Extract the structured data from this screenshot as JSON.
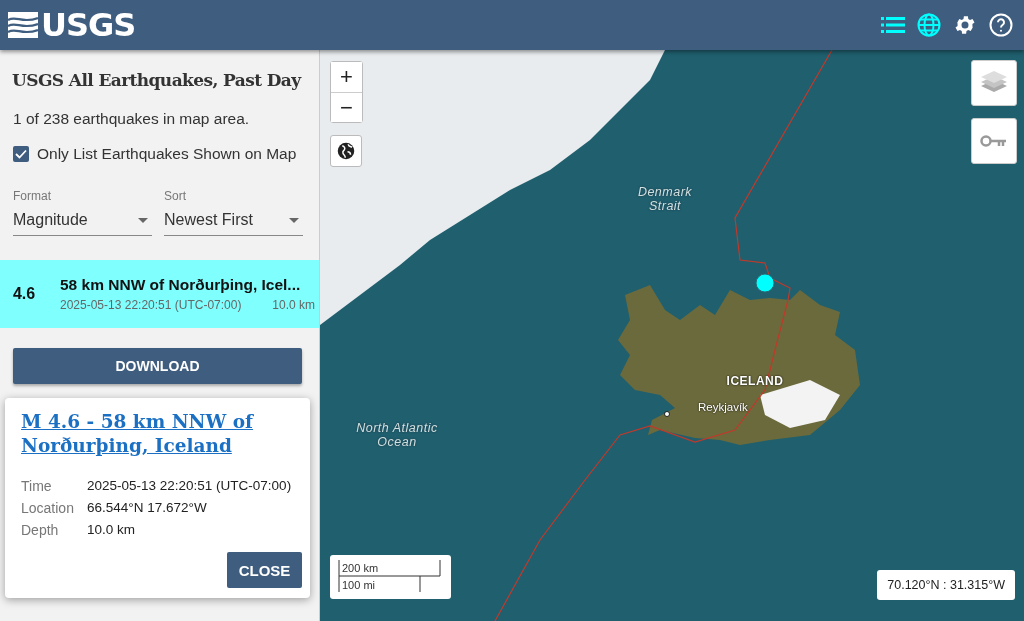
{
  "header": {
    "logo": "USGS",
    "nav": [
      {
        "kind": "list",
        "selected": true
      },
      {
        "kind": "globe",
        "selected": true
      },
      {
        "kind": "settings",
        "selected": false
      },
      {
        "kind": "help",
        "selected": false
      }
    ]
  },
  "sidebar": {
    "title": "USGS All Earthquakes, Past Day",
    "count": "1 of 238 earthquakes in map area.",
    "filter": {
      "label": "Only List Earthquakes Shown on Map",
      "checked": true
    },
    "selects": [
      {
        "label": "Format",
        "value": "Magnitude"
      },
      {
        "label": "Sort",
        "value": "Newest First"
      }
    ],
    "earthquakes": [
      {
        "magnitude": "4.6",
        "place": "58 km NNW of Norðurþing, Icel...",
        "time": "2025-05-13 22:20:51 (UTC-07:00)",
        "depth": "10.0 km",
        "selected": true
      }
    ],
    "download": "DOWNLOAD"
  },
  "popup": {
    "title": "M 4.6 - 58 km NNW of Norðurþing, Iceland",
    "details": [
      {
        "label": "Time",
        "value": "2025-05-13 22:20:51 (UTC-07:00)"
      },
      {
        "label": "Location",
        "value": "66.544°N 17.672°W"
      },
      {
        "label": "Depth",
        "value": "10.0 km"
      }
    ],
    "close": "CLOSE"
  },
  "map": {
    "zoom_in": "+",
    "zoom_out": "−",
    "labels": [
      {
        "kind": "sea",
        "text": "Denmark\nStrait"
      },
      {
        "kind": "country",
        "text": "ICELAND"
      },
      {
        "kind": "city",
        "text": "Reykjavík"
      },
      {
        "kind": "sea",
        "text": "North Atlantic\nOcean"
      }
    ],
    "scale": {
      "metric": "200 km",
      "imperial": "100 mi"
    },
    "coordinates": "70.120°N : 31.315°W"
  }
}
